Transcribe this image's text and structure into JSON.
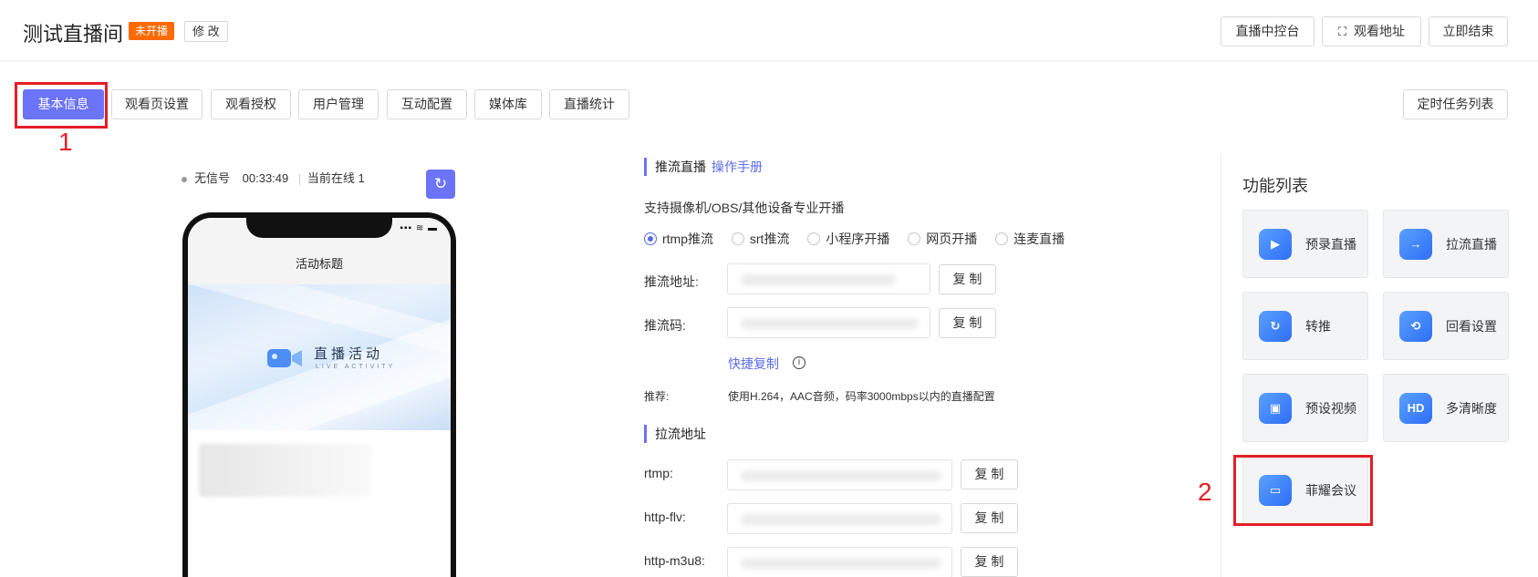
{
  "header": {
    "title": "测试直播间",
    "status_badge": "未开播",
    "edit_label": "修 改",
    "buttons": {
      "console": "直播中控台",
      "watch_url": "观看地址",
      "end_now": "立即结束"
    }
  },
  "tabs": [
    "基本信息",
    "观看页设置",
    "观看授权",
    "用户管理",
    "互动配置",
    "媒体库",
    "直播统计"
  ],
  "active_tab": "基本信息",
  "scheduled_tasks_label": "定时任务列表",
  "annotations": [
    "1",
    "2"
  ],
  "preview": {
    "signal": "无信号",
    "time": "00:33:49",
    "online": "当前在线 1",
    "phone_title": "活动标题",
    "banner_title": "直播活动",
    "banner_subtitle": "LIVE ACTIVITY",
    "status_bar": "▪▪▪ ≋ ▬"
  },
  "push": {
    "section_title": "推流直播",
    "manual_link": "操作手册",
    "description": "支持摄像机/OBS/其他设备专业开播",
    "options": [
      "rtmp推流",
      "srt推流",
      "小程序开播",
      "网页开播",
      "连麦直播"
    ],
    "selected_option": "rtmp推流",
    "address_label": "推流地址:",
    "code_label": "推流码:",
    "copy_label": "复 制",
    "quick_copy": "快捷复制",
    "recommend_label": "推荐:",
    "recommend_text": "使用H.264，AAC音频，码率3000mbps以内的直播配置"
  },
  "pull": {
    "section_title": "拉流地址",
    "rows": [
      {
        "label": "rtmp:",
        "copy": "复 制"
      },
      {
        "label": "http-flv:",
        "copy": "复 制"
      },
      {
        "label": "http-m3u8:",
        "copy": "复 制"
      }
    ]
  },
  "features": {
    "title": "功能列表",
    "items": [
      {
        "label": "预录直播",
        "icon": "camera-icon"
      },
      {
        "label": "拉流直播",
        "icon": "arrow-right-icon"
      },
      {
        "label": "转推",
        "icon": "relay-icon"
      },
      {
        "label": "回看设置",
        "icon": "replay-icon"
      },
      {
        "label": "预设视频",
        "icon": "video-preset-icon"
      },
      {
        "label": "多清晰度",
        "icon": "hd-icon"
      },
      {
        "label": "菲耀会议",
        "icon": "meeting-icon"
      }
    ]
  },
  "colors": {
    "accent": "#6b73f6",
    "badge": "#ff6a00",
    "link": "#5b6bea",
    "annotation": "#e31f26"
  }
}
